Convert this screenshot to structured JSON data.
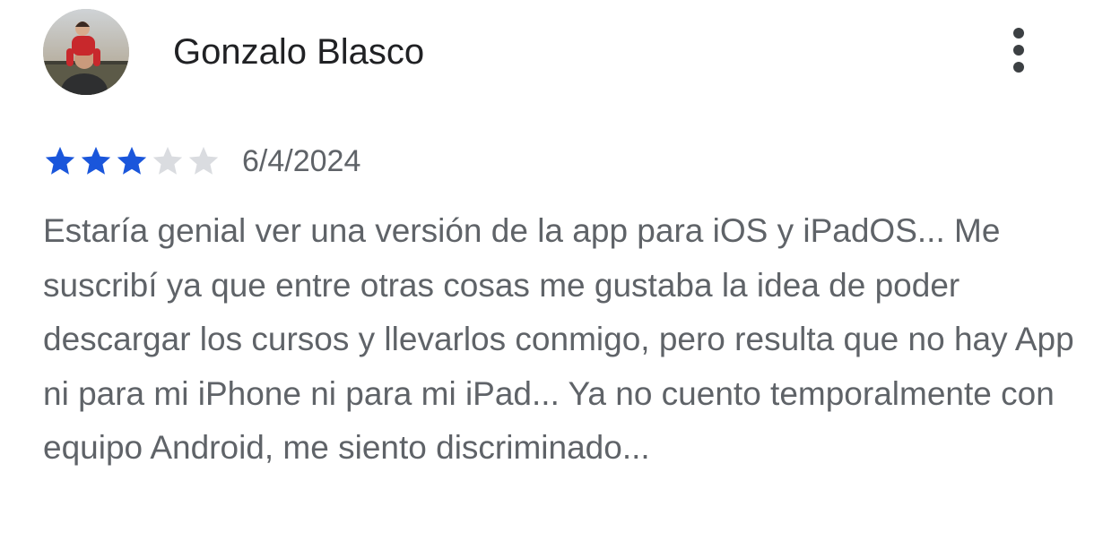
{
  "review": {
    "author_name": "Gonzalo Blasco",
    "rating": 3,
    "max_rating": 5,
    "date": "6/4/2024",
    "text": "Estaría genial ver una versión de la app para iOS y iPadOS... Me suscribí ya que entre otras cosas me gustaba la idea de poder descargar los cursos y llevarlos conmigo, pero resulta que no hay App ni para mi iPhone ni para mi iPad... Ya no cuento temporalmente con equipo Android, me siento discriminado..."
  },
  "icons": {
    "avatar": "avatar-photo",
    "menu": "more-vert-icon",
    "star_filled": "star-filled-icon",
    "star_empty": "star-empty-icon"
  },
  "colors": {
    "star_filled": "#1a56db",
    "star_empty": "#dadce0",
    "author_text": "#202124",
    "secondary_text": "#5f6368"
  }
}
